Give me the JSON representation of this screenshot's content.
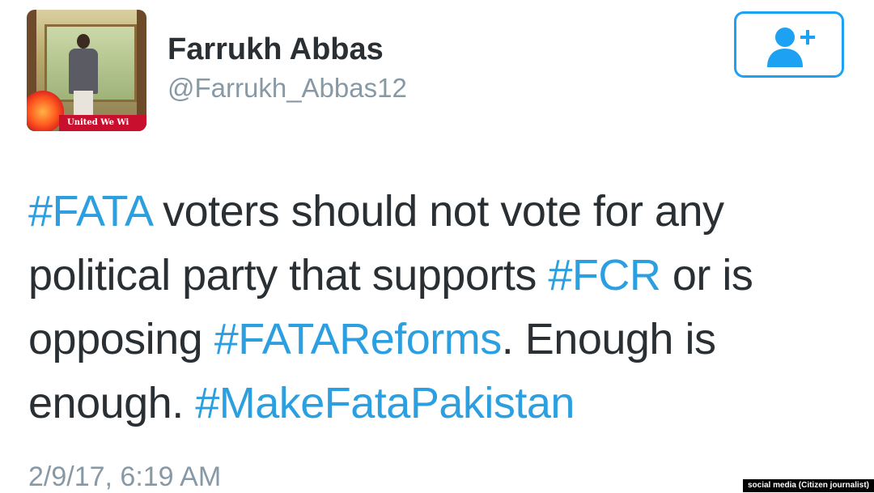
{
  "profile": {
    "display_name": "Farrukh Abbas",
    "handle": "@Farrukh_Abbas12",
    "avatar_banner_text": "United We Wi"
  },
  "follow_button": {
    "icon": "add-user-icon"
  },
  "tweet": {
    "segments": [
      {
        "type": "hashtag",
        "text": "#FATA"
      },
      {
        "type": "text",
        "text": " voters should not vote for any political party that supports "
      },
      {
        "type": "hashtag",
        "text": "#FCR"
      },
      {
        "type": "text",
        "text": " or is opposing "
      },
      {
        "type": "hashtag",
        "text": "#FATAReforms"
      },
      {
        "type": "text",
        "text": ". Enough is enough. "
      },
      {
        "type": "hashtag",
        "text": "#MakeFataPakistan"
      }
    ],
    "timestamp": "2/9/17, 6:19 AM"
  },
  "credit": "social media (Citizen journalist)",
  "colors": {
    "accent": "#1da1f2",
    "hashtag": "#2b9fe0",
    "text": "#292f33",
    "muted": "#8899a6"
  }
}
